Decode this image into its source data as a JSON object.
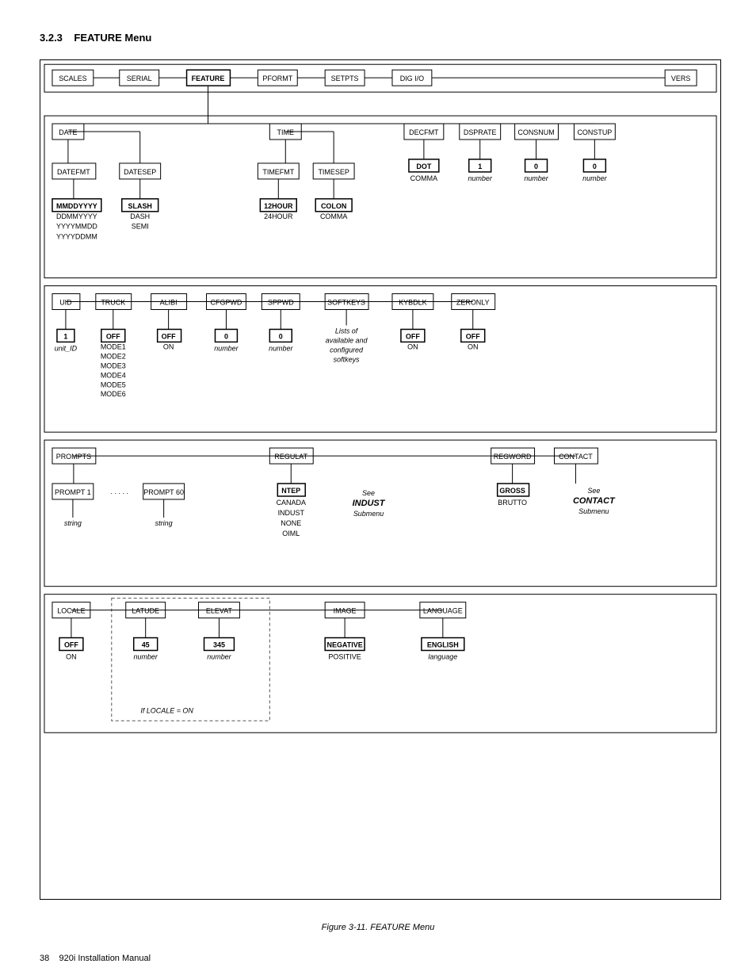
{
  "section": {
    "number": "3.2.3",
    "title": "FEATURE Menu"
  },
  "figure": {
    "caption": "Figure 3-11. FEATURE Menu"
  },
  "footer": {
    "page_number": "38",
    "manual": "920i Installation Manual"
  }
}
